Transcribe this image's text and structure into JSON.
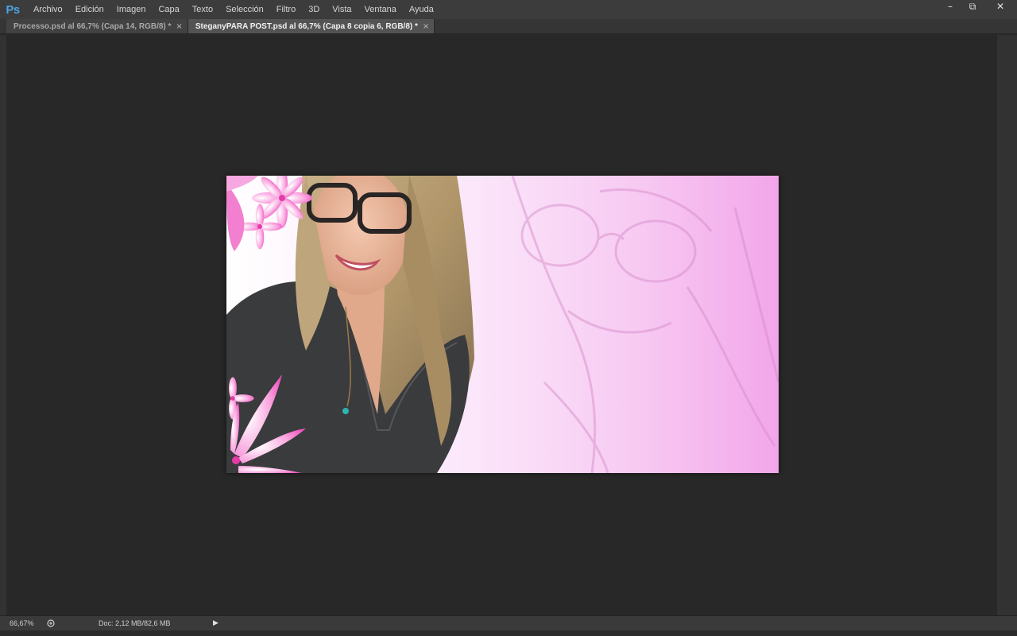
{
  "app": {
    "logo": "Ps"
  },
  "menu": [
    {
      "label": "Archivo"
    },
    {
      "label": "Edición"
    },
    {
      "label": "Imagen"
    },
    {
      "label": "Capa"
    },
    {
      "label": "Texto"
    },
    {
      "label": "Selección"
    },
    {
      "label": "Filtro"
    },
    {
      "label": "3D"
    },
    {
      "label": "Vista"
    },
    {
      "label": "Ventana"
    },
    {
      "label": "Ayuda"
    }
  ],
  "window_controls": {
    "minimize": "–",
    "restore": "⧉",
    "close": "✕"
  },
  "tabs": [
    {
      "label": "Processo.psd al 66,7% (Capa 14, RGB/8) *",
      "close": "×",
      "active": false
    },
    {
      "label": "SteganyPARA POST.psd al 66,7% (Capa 8 copia 6, RGB/8) *",
      "close": "×",
      "active": true
    }
  ],
  "status": {
    "zoom": "66,67%",
    "doc_info": "Doc: 2,12 MB/82,6 MB",
    "arrow": "▶"
  },
  "colors": {
    "accent": "#4aa3e0",
    "flower": "#f06ac8",
    "background_pink": "#f6c6f2"
  }
}
